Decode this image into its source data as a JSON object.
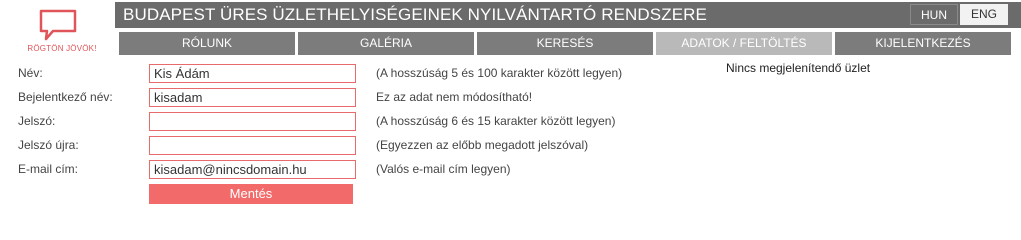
{
  "logo": {
    "text": "RÖGTÖN JÖVÖK!",
    "color": "#e0555a"
  },
  "header": {
    "title": "BUDAPEST ÜRES ÜZLETHELYISÉGEINEK NYILVÁNTARTÓ RENDSZERE",
    "lang_hun": "HUN",
    "lang_eng": "ENG"
  },
  "nav": {
    "items": [
      {
        "label": "RÓLUNK"
      },
      {
        "label": "GALÉRIA"
      },
      {
        "label": "KERESÉS"
      },
      {
        "label": "ADATOK / FELTÖLTÉS"
      },
      {
        "label": "KIJELENTKEZÉS"
      }
    ]
  },
  "form": {
    "name": {
      "label": "Név:",
      "value": "Kis Ádám",
      "hint": "(A hosszúság 5 és 100 karakter között legyen)"
    },
    "login": {
      "label": "Bejelentkező név:",
      "value": "kisadam",
      "hint": "Ez az adat nem módosítható!"
    },
    "password": {
      "label": "Jelszó:",
      "value": "",
      "hint": "(A hosszúság 6 és 15 karakter között legyen)"
    },
    "password2": {
      "label": "Jelszó újra:",
      "value": "",
      "hint": "(Egyezzen az előbb megadott jelszóval)"
    },
    "email": {
      "label": "E-mail cím:",
      "value": "kisadam@nincsdomain.hu",
      "hint": "(Valós e-mail cím legyen)"
    },
    "save_label": "Mentés"
  },
  "sidebar": {
    "message": "Nincs megjelenítendő üzlet"
  },
  "colors": {
    "accent": "#f26a6a",
    "header_bg": "#6b6b6b",
    "nav_bg": "#7c7c7c",
    "nav_active_bg": "#b9b9b9"
  }
}
